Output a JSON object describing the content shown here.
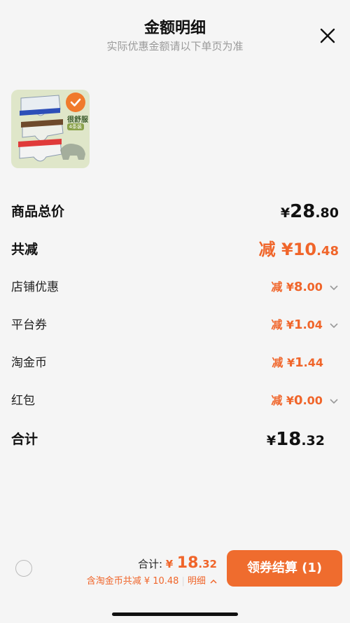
{
  "header": {
    "title": "金额明细",
    "subtitle": "实际优惠金额请以下单页为准"
  },
  "product": {
    "badge_text": "很舒服",
    "badge_sub": "4条装"
  },
  "rows": [
    {
      "label": "商品总价",
      "prefix": "",
      "currency": "¥",
      "integer": "28",
      "decimal": ".80"
    },
    {
      "label": "共减",
      "prefix": "减 ",
      "currency": "¥",
      "integer": "10",
      "decimal": ".48"
    },
    {
      "label": "店铺优惠",
      "prefix": "减 ",
      "currency": "¥",
      "integer": "8",
      "decimal": ".00"
    },
    {
      "label": "平台券",
      "prefix": "减 ",
      "currency": "¥",
      "integer": "1",
      "decimal": ".04"
    },
    {
      "label": "淘金币",
      "prefix": "减 ",
      "currency": "¥",
      "integer": "1",
      "decimal": ".44"
    },
    {
      "label": "红包",
      "prefix": "减 ",
      "currency": "¥",
      "integer": "0",
      "decimal": ".00"
    },
    {
      "label": "合计",
      "prefix": "",
      "currency": "¥",
      "integer": "18",
      "decimal": ".32"
    }
  ],
  "footer": {
    "total_label": "合计: ",
    "total_currency": "¥",
    "total_integer": "18",
    "total_decimal": ".32",
    "savings_text": "含淘金币共减 ¥ 10.48",
    "detail_link": "明细",
    "checkout_label": "领券结算 (1)"
  },
  "colors": {
    "accent": "#f0652a",
    "checkout_bg": "#ef6c2e"
  }
}
